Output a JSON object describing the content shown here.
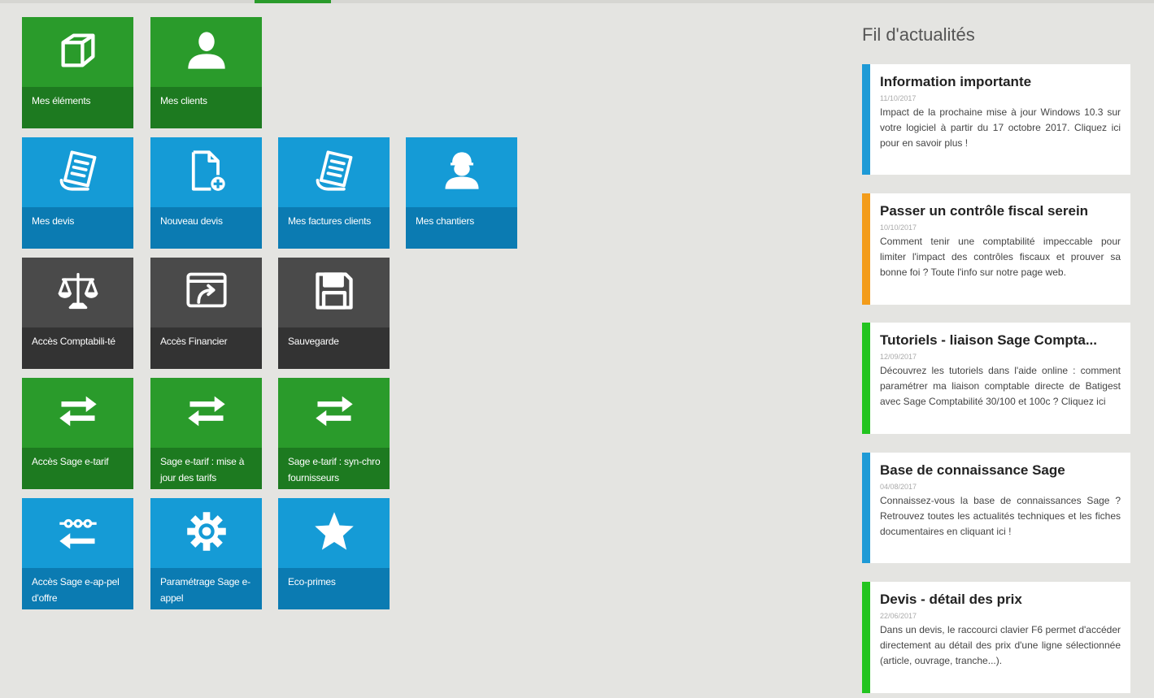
{
  "tabs": {
    "active_color": "#2a9b2b"
  },
  "tiles": [
    {
      "label": "Mes éléments",
      "color": "green",
      "icon": "box-icon"
    },
    {
      "label": "Mes clients",
      "color": "green",
      "icon": "user-icon"
    },
    {
      "label": "Mes devis",
      "color": "blue",
      "icon": "document-list-icon"
    },
    {
      "label": "Nouveau devis",
      "color": "blue",
      "icon": "new-document-icon"
    },
    {
      "label": "Mes factures clients",
      "color": "blue",
      "icon": "invoice-icon"
    },
    {
      "label": "Mes chantiers",
      "color": "blue",
      "icon": "worker-icon"
    },
    {
      "label": "Accès Comptabili-té",
      "color": "dark",
      "icon": "scales-icon"
    },
    {
      "label": "Accès Financier",
      "color": "dark",
      "icon": "window-export-icon"
    },
    {
      "label": "Sauvegarde",
      "color": "dark",
      "icon": "floppy-disk-icon"
    },
    {
      "label": "Accès Sage e-tarif",
      "color": "green",
      "icon": "exchange-arrows-icon"
    },
    {
      "label": "Sage e-tarif : mise à jour des tarifs",
      "color": "green",
      "icon": "exchange-arrows-icon"
    },
    {
      "label": "Sage e-tarif : syn-chro fournisseurs",
      "color": "green",
      "icon": "exchange-arrows-icon"
    },
    {
      "label": "Accès Sage e-ap-pel d'offre",
      "color": "blue",
      "icon": "connector-arrow-icon"
    },
    {
      "label": "Paramétrage Sage e-appel",
      "color": "blue",
      "icon": "gear-icon"
    },
    {
      "label": "Eco-primes",
      "color": "blue",
      "icon": "star-icon"
    }
  ],
  "news": {
    "heading": "Fil d'actualités",
    "items": [
      {
        "title": "Information importante",
        "date": "11/10/2017",
        "accent": "#1e9ad6",
        "body": "Impact de la prochaine mise à jour Windows 10.3 sur votre logiciel à partir du 17 octobre 2017. Cliquez ici pour en savoir plus !"
      },
      {
        "title": "Passer un contrôle fiscal serein",
        "date": "10/10/2017",
        "accent": "#f39c1a",
        "body": "Comment tenir une comptabilité impeccable pour limiter l'impact des contrôles fiscaux et prouver sa bonne foi ? Toute l'info sur notre page web."
      },
      {
        "title": "Tutoriels - liaison Sage Compta...",
        "date": "12/09/2017",
        "accent": "#22c41f",
        "body": "Découvrez les tutoriels dans l'aide online : comment paramétrer ma liaison comptable directe de Batigest avec Sage Comptabilité 30/100 et 100c ? Cliquez ici"
      },
      {
        "title": "Base de connaissance Sage",
        "date": "04/08/2017",
        "accent": "#1e9ad6",
        "body": "Connaissez-vous la base de connaissances Sage ? Retrouvez toutes les actualités techniques et les fiches documentaires en cliquant ici !"
      },
      {
        "title": "Devis - détail des prix",
        "date": "22/06/2017",
        "accent": "#22c41f",
        "body": "Dans un devis, le raccourci clavier F6 permet d'accéder directement au détail des prix d'une ligne sélectionnée (article, ouvrage, tranche...)."
      }
    ]
  }
}
